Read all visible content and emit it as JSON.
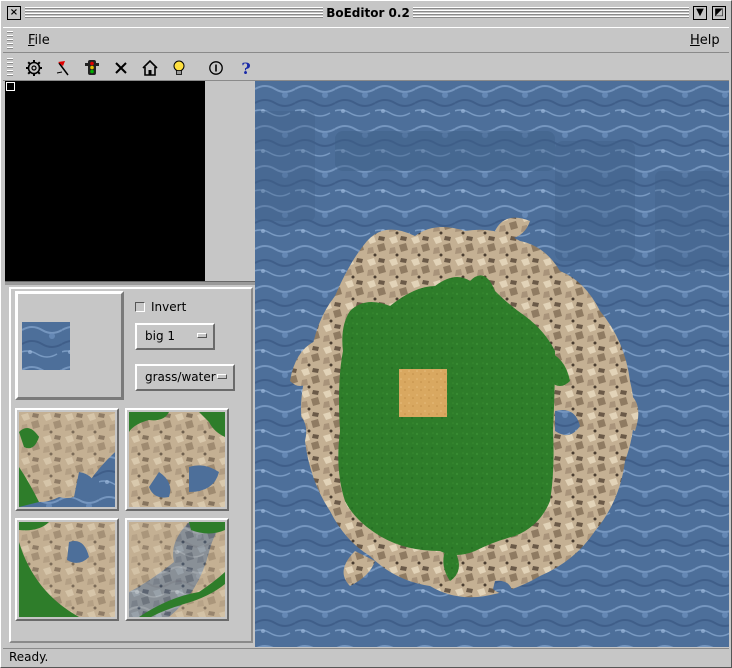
{
  "window": {
    "title": "BoEditor 0.2",
    "close_glyph": "×",
    "min_glyph": "▼",
    "max_glyph": "◩"
  },
  "menu": {
    "file": {
      "mnemonic": "F",
      "rest": "ile"
    },
    "help": {
      "mnemonic": "H",
      "rest": "elp"
    }
  },
  "toolbar": {
    "tools": [
      {
        "name": "gear-icon"
      },
      {
        "name": "flag-icon"
      },
      {
        "name": "traffic-light-icon"
      },
      {
        "name": "cross-icon"
      },
      {
        "name": "house-icon"
      },
      {
        "name": "lightbulb-icon"
      },
      {
        "name": "info-icon"
      },
      {
        "name": "question-icon",
        "glyph": "?"
      }
    ]
  },
  "palette": {
    "invert_label": "Invert",
    "invert_checked": false,
    "size_value": "big 1",
    "terrain_value": "grass/water"
  },
  "status": {
    "text": "Ready."
  },
  "colors": {
    "water": "#4d6f9a",
    "grass": "#2e7d2a",
    "rock": "#c4b093",
    "sand": "#d9a860"
  }
}
